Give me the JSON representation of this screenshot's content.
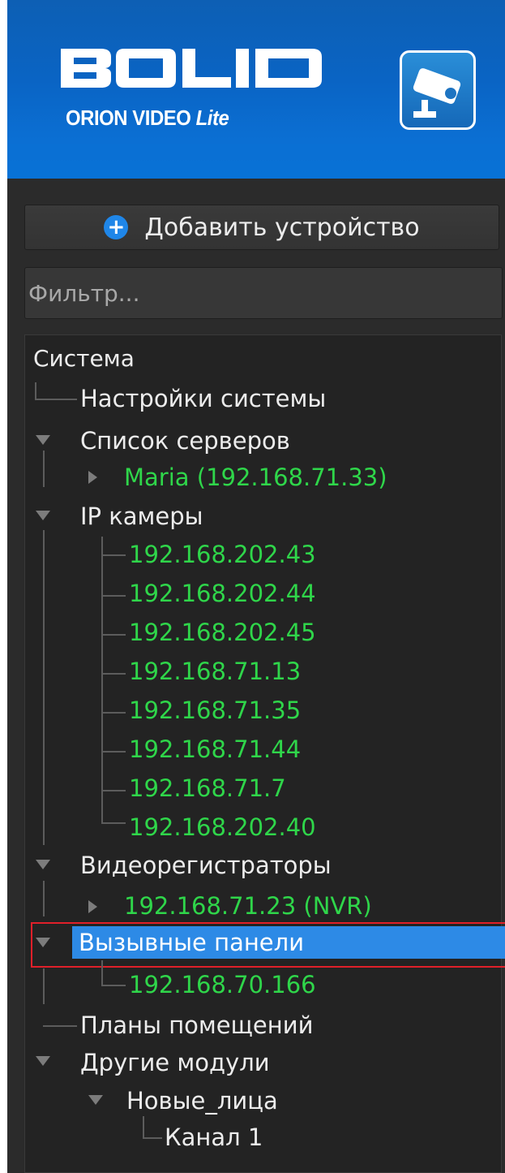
{
  "app": {
    "brand": "BOLID",
    "product": "ORION VIDEO",
    "edition": "Lite",
    "camera_button_icon": "cctv-camera-icon"
  },
  "toolbar": {
    "add_device_label": "Добавить устройство",
    "add_icon": "plus-circle-icon"
  },
  "filter": {
    "placeholder": "Фильтр..."
  },
  "tree": {
    "root": "Система",
    "system_settings": "Настройки системы",
    "servers": {
      "label": "Список серверов",
      "items": [
        "Maria (192.168.71.33)"
      ]
    },
    "ip_cameras": {
      "label": "IP камеры",
      "items": [
        "192.168.202.43",
        "192.168.202.44",
        "192.168.202.45",
        "192.168.71.13",
        "192.168.71.35",
        "192.168.71.44",
        "192.168.71.7",
        "192.168.202.40"
      ]
    },
    "recorders": {
      "label": "Видеорегистраторы",
      "items": [
        "192.168.71.23 (NVR)"
      ]
    },
    "call_panels": {
      "label": "Вызывные панели",
      "items": [
        "192.168.70.166"
      ]
    },
    "room_plans": "Планы помещений",
    "other_modules": {
      "label": "Другие модули",
      "child": {
        "label": "Новые_лица",
        "items": [
          "Канал 1"
        ]
      }
    }
  },
  "colors": {
    "accent": "#2d8ae6",
    "online": "#2fd64a",
    "highlight_box": "#e0202a"
  }
}
